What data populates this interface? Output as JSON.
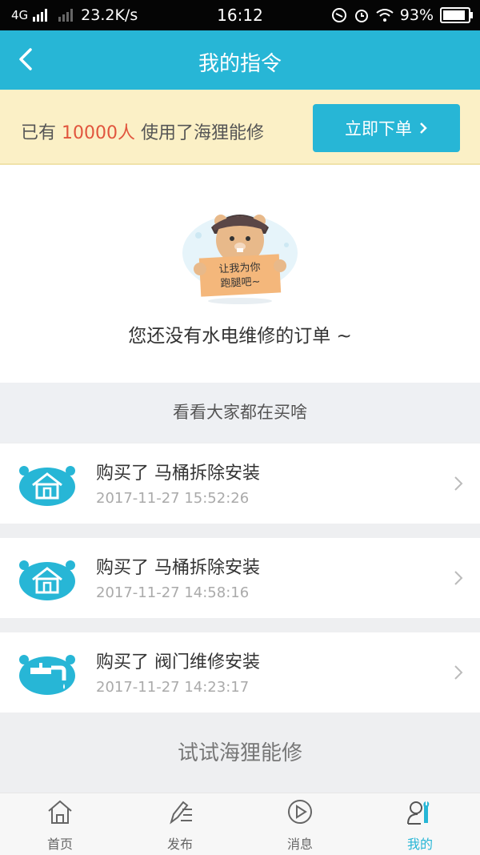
{
  "status_bar": {
    "network": "4G",
    "speed": "23.2K/s",
    "time": "16:12",
    "battery": "93%"
  },
  "header": {
    "title": "我的指令"
  },
  "promo": {
    "prefix": "已有 ",
    "count": "10000人",
    "suffix": " 使用了海狸能修",
    "button_label": "立即下单"
  },
  "empty_state": {
    "illustration_text": "让我为你跑腿吧~",
    "message": "您还没有水电维修的订单 ~"
  },
  "recent": {
    "heading": "看看大家都在买啥",
    "orders": [
      {
        "title": "购买了 马桶拆除安装",
        "time": "2017-11-27 15:52:26",
        "icon": "house-icon"
      },
      {
        "title": "购买了 马桶拆除安装",
        "time": "2017-11-27 14:58:16",
        "icon": "house-icon"
      },
      {
        "title": "购买了 阀门维修安装",
        "time": "2017-11-27 14:23:17",
        "icon": "faucet-icon"
      }
    ]
  },
  "try_section": {
    "title": "试试海狸能修"
  },
  "tabbar": {
    "items": [
      {
        "label": "首页",
        "icon": "home-icon"
      },
      {
        "label": "发布",
        "icon": "edit-icon"
      },
      {
        "label": "消息",
        "icon": "play-circle-icon"
      },
      {
        "label": "我的",
        "icon": "user-wrench-icon"
      }
    ],
    "active_index": 3
  },
  "colors": {
    "accent": "#27b6d6",
    "promo_bg": "#fbf0c6",
    "highlight": "#e1553d"
  }
}
